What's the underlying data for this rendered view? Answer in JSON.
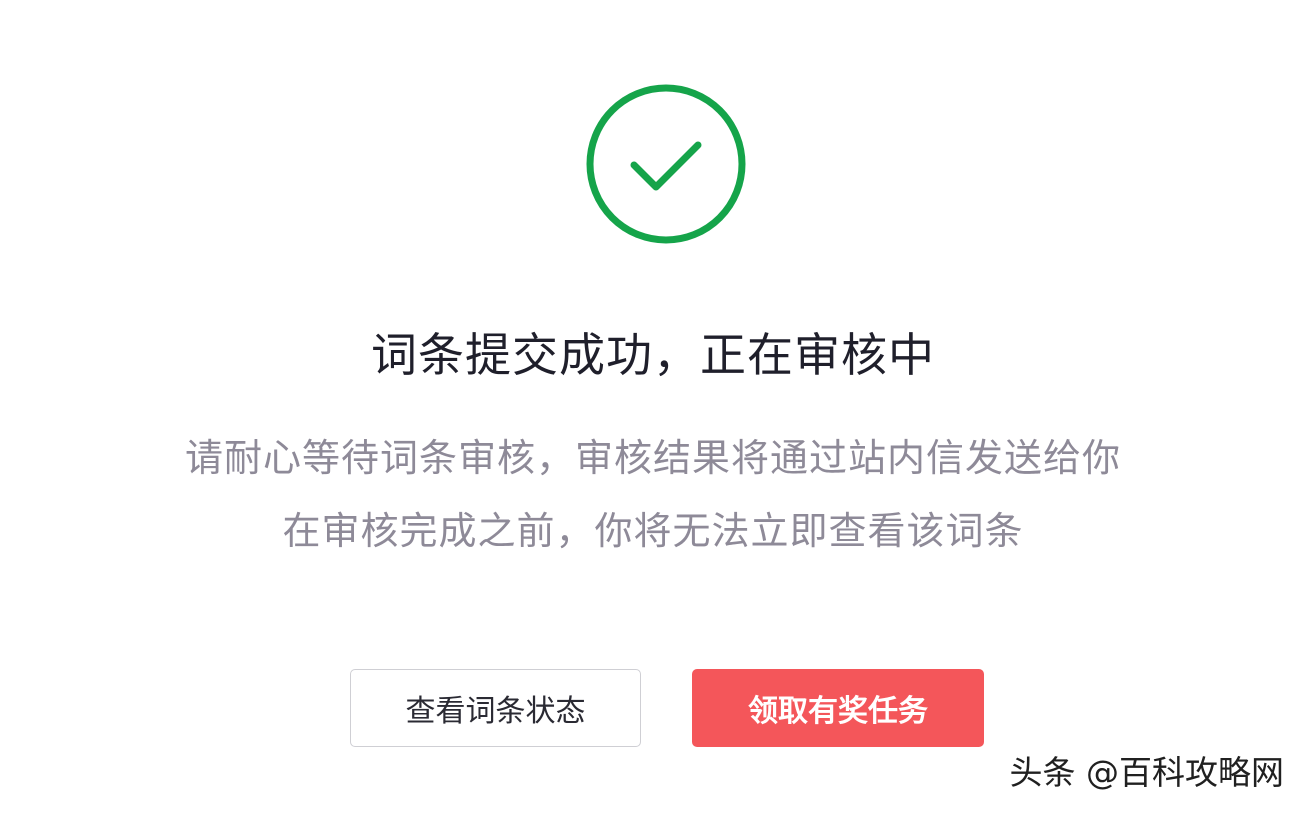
{
  "icon": {
    "name": "check-circle-icon",
    "color": "#15a44a"
  },
  "title": "词条提交成功，正在审核中",
  "description": {
    "line1": "请耐心等待词条审核，审核结果将通过站内信发送给你",
    "line2": "在审核完成之前，你将无法立即查看该词条"
  },
  "buttons": {
    "view_status_label": "查看词条状态",
    "claim_task_label": "领取有奖任务"
  },
  "colors": {
    "primary": "#f4565a",
    "success": "#15a44a"
  },
  "watermark": {
    "text": "头条 @百科攻略网"
  }
}
